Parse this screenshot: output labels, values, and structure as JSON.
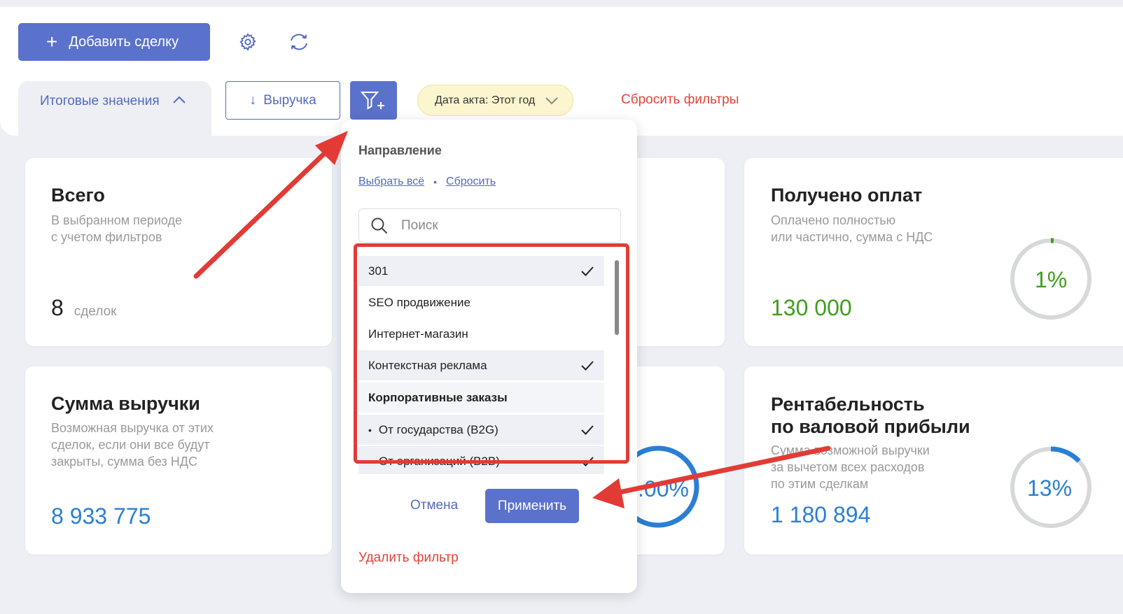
{
  "toolbar": {
    "add_deal_label": "Добавить сделку",
    "plus_glyph": "+"
  },
  "filters": {
    "totals_tab": "Итоговые значения",
    "revenue_sort": "Выручка",
    "sort_arrow": "↓",
    "date_chip": "Дата акта: Этот год",
    "reset_filters": "Сбросить фильтры"
  },
  "cards": {
    "total": {
      "title": "Всего",
      "subtitle_1": "В выбранном периоде",
      "subtitle_2": "с учетом фильтров",
      "count": "8",
      "unit": "сделок"
    },
    "paid": {
      "title": "Получено оплат",
      "subtitle_1": "Оплачено полностью",
      "subtitle_2": "или частично, сумма с НДС",
      "amount": "130 000",
      "percent_label": "1%",
      "percent_value": 1,
      "color": "#3f9e1c"
    },
    "revenue": {
      "title": "Сумма выручки",
      "subtitle_1": "Возможная выручка от этих",
      "subtitle_2": "сделок, если они все будут",
      "subtitle_3": "закрыты, сумма без НДС",
      "amount": "8 933 775",
      "color": "#2a7fd4"
    },
    "middle_partial": {
      "percent_label": ".00%",
      "percent_value": 100
    },
    "profitability": {
      "title_1": "Рентабельность",
      "title_2": "по валовой прибыли",
      "subtitle_1": "Сумма возможной выручки",
      "subtitle_2": "за вычетом всех расходов",
      "subtitle_3": "по этим сделкам",
      "amount": "1 180 894",
      "percent_label": "13%",
      "percent_value": 13,
      "color": "#2a7fd4"
    }
  },
  "dropdown": {
    "title": "Направление",
    "select_all": "Выбрать всё",
    "dot": "•",
    "reset": "Сбросить",
    "search_placeholder": "Поиск",
    "items": [
      {
        "label": "301",
        "selected": true
      },
      {
        "label": "SEO продвижение",
        "selected": false
      },
      {
        "label": "Интернет-магазин",
        "selected": false
      },
      {
        "label": "Контекстная реклама",
        "selected": true
      },
      {
        "label": "Корпоративные заказы",
        "selected": false,
        "group": true
      },
      {
        "label": "От государства (B2G)",
        "selected": true,
        "child": true
      },
      {
        "label": "От организаций (B2B)",
        "selected": true,
        "child": true
      }
    ],
    "bullet": "•",
    "cancel": "Отмена",
    "apply": "Применить",
    "delete_filter": "Удалить фильтр"
  },
  "colors": {
    "accent": "#5b72cc",
    "danger": "#e0443b",
    "annotation": "#e23b36",
    "ring_track": "#d6d9d8"
  },
  "icons": [
    "plus-icon",
    "gear-icon",
    "refresh-icon",
    "chevron-up-icon",
    "arrow-down-icon",
    "filter-plus-icon",
    "chevron-down-icon",
    "search-icon",
    "check-icon"
  ]
}
